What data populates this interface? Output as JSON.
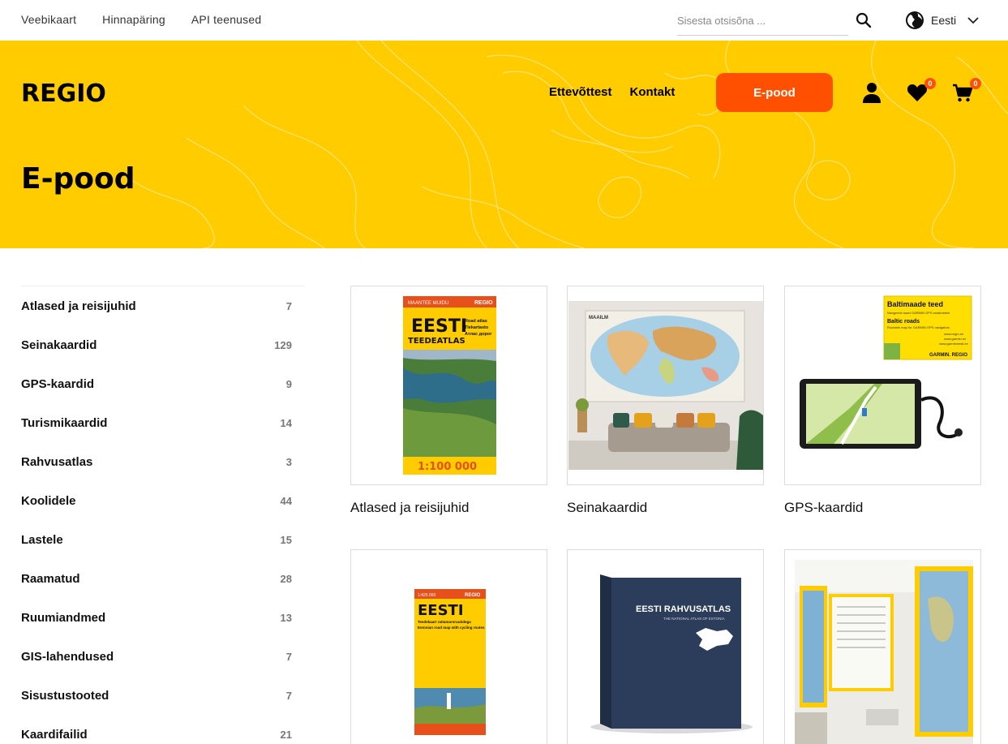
{
  "topbar": {
    "links": [
      "Veebikaart",
      "Hinnapäring",
      "API teenused"
    ],
    "search_placeholder": "Sisesta otsisõna ...",
    "language": "Eesti"
  },
  "header": {
    "logo": "REGIO",
    "nav": [
      "Ettevõttest",
      "Kontakt"
    ],
    "cta_label": "E-pood",
    "wishlist_count": "0",
    "cart_count": "0",
    "page_title": "E-pood"
  },
  "sidebar": {
    "categories": [
      {
        "name": "Atlased ja reisijuhid",
        "count": "7"
      },
      {
        "name": "Seinakaardid",
        "count": "129"
      },
      {
        "name": "GPS-kaardid",
        "count": "9"
      },
      {
        "name": "Turismikaardid",
        "count": "14"
      },
      {
        "name": "Rahvusatlas",
        "count": "3"
      },
      {
        "name": "Koolidele",
        "count": "44"
      },
      {
        "name": "Lastele",
        "count": "15"
      },
      {
        "name": "Raamatud",
        "count": "28"
      },
      {
        "name": "Ruumiandmed",
        "count": "13"
      },
      {
        "name": "GIS-lahendused",
        "count": "7"
      },
      {
        "name": "Sisustustooted",
        "count": "7"
      },
      {
        "name": "Kaardifailid",
        "count": "21"
      }
    ]
  },
  "products": [
    {
      "caption": "Atlased ja reisijuhid",
      "image_text": {
        "top_left": "MAANTEE MUIDU",
        "brand": "REGIO",
        "title": "EESTI",
        "subtitle": "TEEDEATLAS",
        "bullets": [
          "Road atlas",
          "Tiekartasto",
          "Атлас дорог"
        ],
        "scale": "1:100 000"
      }
    },
    {
      "caption": "Seinakaardid",
      "image_text": {
        "map_title": "MAAILM"
      }
    },
    {
      "caption": "GPS-kaardid",
      "image_text": {
        "title": "Baltimaade teed",
        "line1": "Navigeeriv kaart GARMIN GPS seadmetele",
        "subtitle": "Baltic roads",
        "line2": "Routable map for GARMIN GPS navigators",
        "urls": [
          "www.regio.ee",
          "www.garmin.ee",
          "www.garmineesti.ee"
        ],
        "brands": "GARMIN. REGIO"
      }
    },
    {
      "caption": "",
      "image_text": {
        "scale": "1:425 000",
        "brand": "REGIO",
        "title": "EESTI",
        "bullets": [
          "Teedekaart rattamarsruutidega",
          "Estonian road map with cycling routes"
        ]
      }
    },
    {
      "caption": "",
      "image_text": {
        "title": "EESTI RAHVUSATLAS",
        "subtitle": "THE NATIONAL ATLAS OF ESTONIA"
      }
    },
    {
      "caption": "",
      "image_text": {}
    }
  ]
}
